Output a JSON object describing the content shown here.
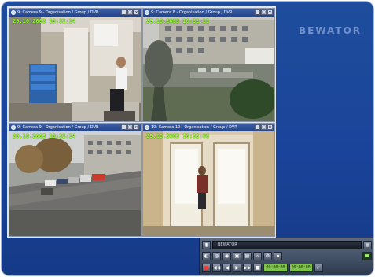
{
  "brand": "BEWATOR",
  "cameras": [
    {
      "title": "9: Camera 9 - Organisation / Group / DVR",
      "timestamp": "29.10.2003 10:32:14"
    },
    {
      "title": "9: Camera 8 - Organisation / Group / DVR",
      "timestamp": "29.10.2003 10:32:15"
    },
    {
      "title": "9: Camera 9 - Organisation / Group / DVR",
      "timestamp": "29.10.2003 10:32:14"
    },
    {
      "title": "10: Camera 10 - Organisation / Group / DVR",
      "timestamp": "29.10.2003 10:32:09"
    }
  ],
  "window_buttons": [
    "_",
    "□",
    "×"
  ],
  "control_panel": {
    "display_label": "BEWATOR",
    "counter_left": "09:00:00",
    "counter_right": "09:00:00",
    "play_symbols": [
      "■",
      "◀◀",
      "◀",
      "▶",
      "▶▶",
      "■"
    ],
    "top_right": "▤"
  },
  "colors": {
    "accent": "#1f4d9c",
    "timestamp": "#9cff3a",
    "record": "#ff3b2f"
  }
}
